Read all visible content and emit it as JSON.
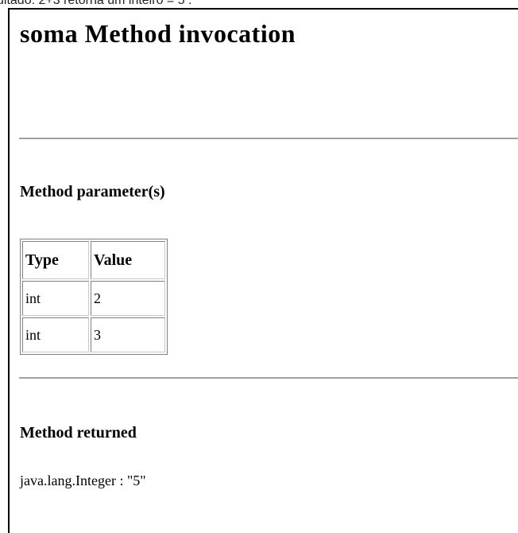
{
  "top_caption": "ultado: 2+3 retorna um inteiro = 5 .",
  "page_title": "soma Method invocation",
  "parameters": {
    "heading": "Method parameter(s)",
    "columns": [
      "Type",
      "Value"
    ],
    "rows": [
      [
        "int",
        "2"
      ],
      [
        "int",
        "3"
      ]
    ]
  },
  "returned": {
    "heading": "Method returned",
    "value": "java.lang.Integer : \"5\""
  }
}
